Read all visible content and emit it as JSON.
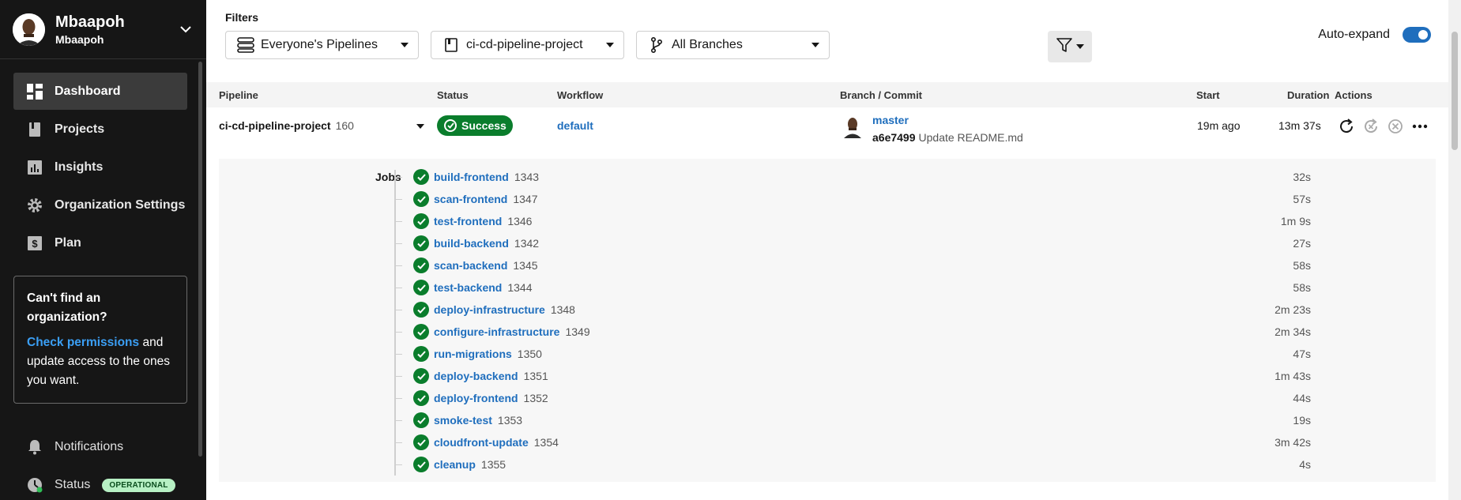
{
  "org": {
    "name": "Mbaapoh",
    "sub": "Mbaapoh"
  },
  "nav": [
    {
      "label": "Dashboard",
      "icon": "dashboard-icon",
      "active": true
    },
    {
      "label": "Projects",
      "icon": "projects-icon"
    },
    {
      "label": "Insights",
      "icon": "insights-icon"
    },
    {
      "label": "Organization Settings",
      "icon": "gear-icon"
    },
    {
      "label": "Plan",
      "icon": "dollar-icon"
    }
  ],
  "help": {
    "title": "Can't find an organization?",
    "link": "Check permissions",
    "body_after": " and update access to the ones you want."
  },
  "bottom": {
    "notifications": "Notifications",
    "status": "Status",
    "status_badge": "OPERATIONAL"
  },
  "filters": {
    "label": "Filters",
    "pipelines": "Everyone's Pipelines",
    "project": "ci-cd-pipeline-project",
    "branches": "All Branches"
  },
  "autoexpand": {
    "label": "Auto-expand",
    "on": true
  },
  "columns": {
    "pipeline": "Pipeline",
    "status": "Status",
    "workflow": "Workflow",
    "branch_commit": "Branch / Commit",
    "start": "Start",
    "duration": "Duration",
    "actions": "Actions"
  },
  "pipeline": {
    "name": "ci-cd-pipeline-project",
    "number": "160",
    "status": "Success",
    "workflow": "default",
    "branch": "master",
    "commit_hash": "a6e7499",
    "commit_msg": "Update README.md",
    "start": "19m ago",
    "duration": "13m 37s"
  },
  "jobs_label": "Jobs",
  "jobs": [
    {
      "name": "build-frontend",
      "num": "1343",
      "dur": "32s"
    },
    {
      "name": "scan-frontend",
      "num": "1347",
      "dur": "57s"
    },
    {
      "name": "test-frontend",
      "num": "1346",
      "dur": "1m 9s"
    },
    {
      "name": "build-backend",
      "num": "1342",
      "dur": "27s"
    },
    {
      "name": "scan-backend",
      "num": "1345",
      "dur": "58s"
    },
    {
      "name": "test-backend",
      "num": "1344",
      "dur": "58s"
    },
    {
      "name": "deploy-infrastructure",
      "num": "1348",
      "dur": "2m 23s"
    },
    {
      "name": "configure-infrastructure",
      "num": "1349",
      "dur": "2m 34s"
    },
    {
      "name": "run-migrations",
      "num": "1350",
      "dur": "47s"
    },
    {
      "name": "deploy-backend",
      "num": "1351",
      "dur": "1m 43s"
    },
    {
      "name": "deploy-frontend",
      "num": "1352",
      "dur": "44s"
    },
    {
      "name": "smoke-test",
      "num": "1353",
      "dur": "19s"
    },
    {
      "name": "cloudfront-update",
      "num": "1354",
      "dur": "3m 42s"
    },
    {
      "name": "cleanup",
      "num": "1355",
      "dur": "4s"
    }
  ],
  "colors": {
    "sidebar_bg": "#161616",
    "success": "#0a7d2c",
    "link": "#1f6ebd",
    "toggle": "#1f6ebd"
  }
}
